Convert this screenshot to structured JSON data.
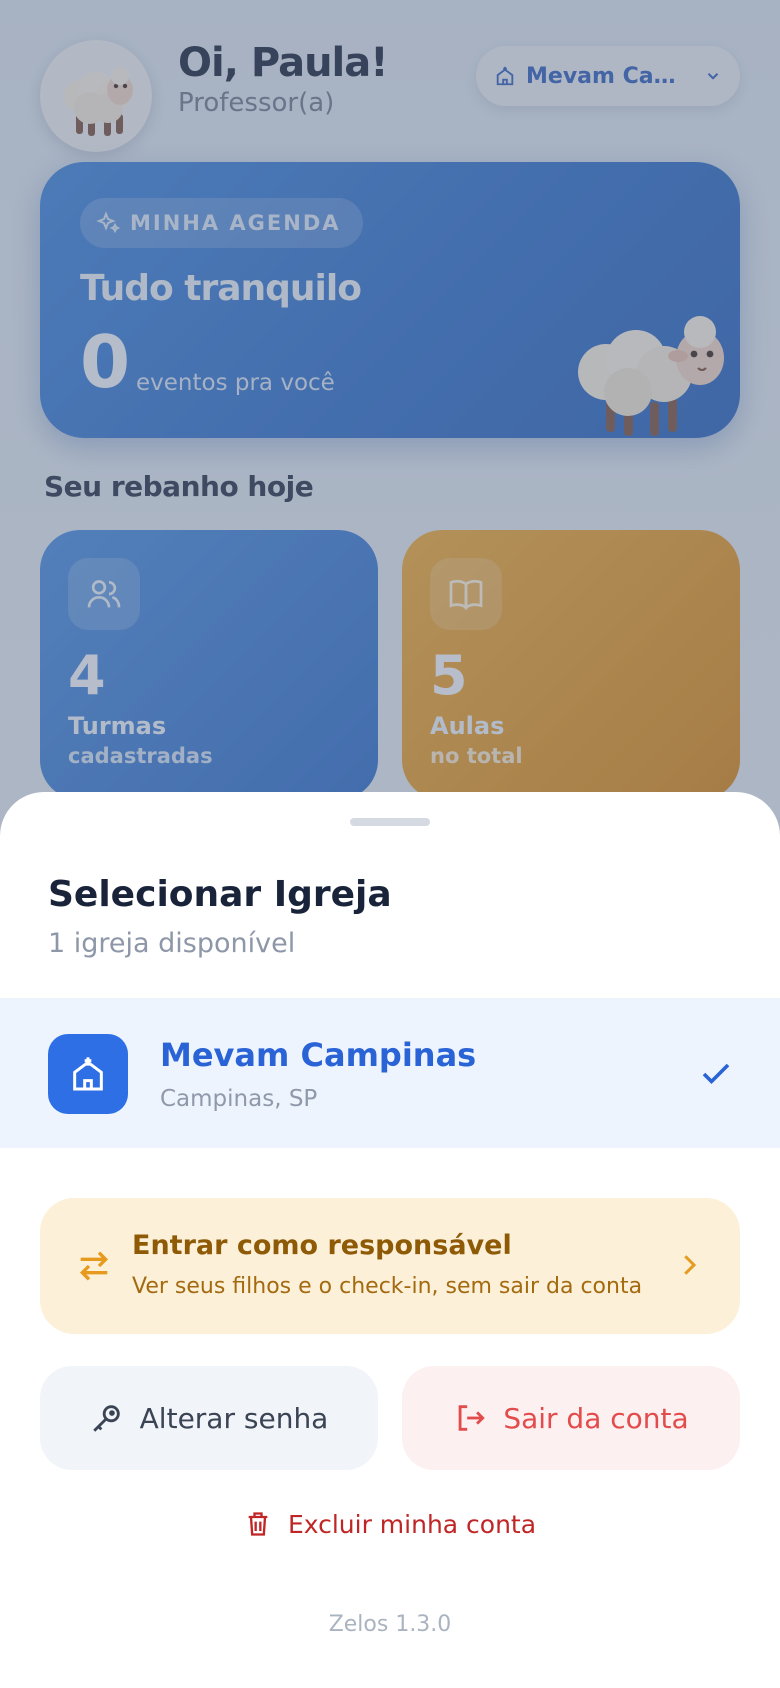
{
  "header": {
    "greeting": "Oi, Paula!",
    "role": "Professor(a)",
    "church_selector": "Mevam Camp..."
  },
  "agenda": {
    "badge": "MINHA AGENDA",
    "title": "Tudo tranquilo",
    "count": "0",
    "count_label": "eventos pra você"
  },
  "flock": {
    "section_title": "Seu rebanho hoje",
    "cards": [
      {
        "value": "4",
        "label": "Turmas",
        "sub": "cadastradas",
        "icon": "users-icon"
      },
      {
        "value": "5",
        "label": "Aulas",
        "sub": "no total",
        "icon": "book-icon"
      }
    ]
  },
  "sheet": {
    "title": "Selecionar Igreja",
    "subtitle": "1 igreja disponível",
    "churches": [
      {
        "name": "Mevam Campinas",
        "location": "Campinas, SP",
        "selected": true
      }
    ],
    "guardian": {
      "title": "Entrar como responsável",
      "subtitle": "Ver seus filhos e o check-in, sem sair da conta"
    },
    "change_password": "Alterar senha",
    "logout": "Sair da conta",
    "delete_account": "Excluir minha conta",
    "version": "Zelos 1.3.0"
  },
  "colors": {
    "primary": "#2f6fe6",
    "agenda_card": "#3f86e0",
    "orange_card": "#f0ad3d",
    "danger": "#e24c4c",
    "warning_bg": "#fdf0d8"
  }
}
